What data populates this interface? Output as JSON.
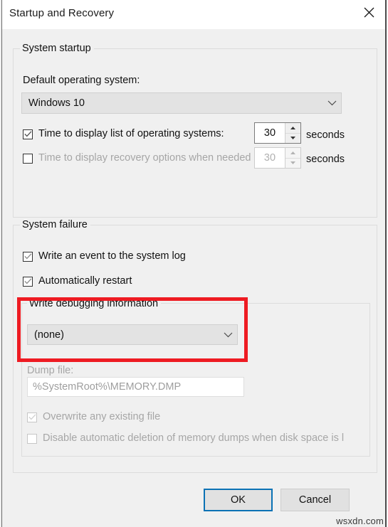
{
  "window": {
    "title": "Startup and Recovery",
    "close_icon": "close-icon"
  },
  "system_startup": {
    "legend": "System startup",
    "default_os_label": "Default operating system:",
    "default_os_value": "Windows 10",
    "default_os_chevron": "chevron-down-icon",
    "time_list": {
      "label": "Time to display list of operating systems:",
      "checked": true,
      "value": "30",
      "unit": "seconds"
    },
    "time_recovery": {
      "label": "Time to display recovery options when needed",
      "checked": false,
      "value": "30",
      "unit": "seconds",
      "disabled": true
    }
  },
  "system_failure": {
    "legend": "System failure",
    "write_event": {
      "label": "Write an event to the system log",
      "checked": true
    },
    "auto_restart": {
      "label": "Automatically restart",
      "checked": true
    },
    "write_debugging": {
      "legend": "Write debugging information",
      "value": "(none)",
      "chevron": "chevron-down-icon",
      "highlight_color": "#ee1b22"
    },
    "dump_file": {
      "label": "Dump file:",
      "value": "%SystemRoot%\\MEMORY.DMP",
      "disabled": true
    },
    "overwrite": {
      "label": "Overwrite any existing file",
      "checked": true,
      "disabled": true
    },
    "disable_deletion": {
      "label": "Disable automatic deletion of memory dumps when disk space is l",
      "checked": false,
      "disabled": true
    }
  },
  "footer": {
    "ok_label": "OK",
    "cancel_label": "Cancel",
    "focus_color": "#0b72b5"
  },
  "watermark": "wsxdn.com"
}
